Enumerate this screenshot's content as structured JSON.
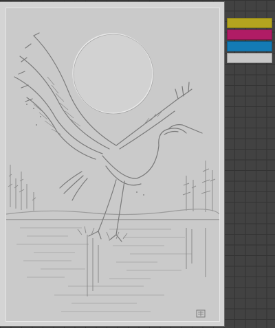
{
  "canvas": {
    "artwork_subject": ""
  },
  "palette": {
    "swatches": [
      {
        "name": "olive",
        "color": "#b3a41f"
      },
      {
        "name": "magenta",
        "color": "#b01c65"
      },
      {
        "name": "blue",
        "color": "#147bb5"
      },
      {
        "name": "light-gray",
        "color": "#c8c8c8"
      }
    ]
  }
}
